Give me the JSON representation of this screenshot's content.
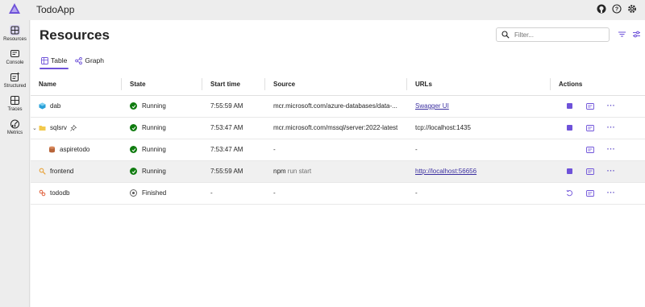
{
  "app": {
    "title": "TodoApp"
  },
  "sidebar": {
    "items": [
      {
        "label": "Resources",
        "icon": "resources-icon",
        "active": true
      },
      {
        "label": "Console",
        "icon": "console-icon"
      },
      {
        "label": "Structured",
        "icon": "structured-logs-icon"
      },
      {
        "label": "Traces",
        "icon": "traces-icon"
      },
      {
        "label": "Metrics",
        "icon": "metrics-icon"
      }
    ]
  },
  "header": {
    "title": "Resources",
    "filter_placeholder": "Filter..."
  },
  "tabs": [
    {
      "label": "Table",
      "icon": "table-icon",
      "active": true
    },
    {
      "label": "Graph",
      "icon": "graph-icon"
    }
  ],
  "table": {
    "columns": [
      "Name",
      "State",
      "Start time",
      "Source",
      "URLs",
      "Actions"
    ],
    "rows": [
      {
        "name": "dab",
        "icon": "container-icon",
        "state": "Running",
        "start": "7:55:59 AM",
        "source": "mcr.microsoft.com/azure-databases/data-...",
        "url": "Swagger UI",
        "url_link": true
      },
      {
        "name": "sqlsrv",
        "icon": "folder-icon",
        "state": "Running",
        "start": "7:53:47 AM",
        "source": "mcr.microsoft.com/mssql/server:2022-latest",
        "url": "tcp://localhost:1435",
        "url_link": false
      },
      {
        "name": "aspiretodo",
        "icon": "database-icon",
        "state": "Running",
        "start": "7:53:47 AM",
        "source": "-",
        "url": "-",
        "url_link": false
      },
      {
        "name": "frontend",
        "icon": "executable-icon",
        "state": "Running",
        "start": "7:55:59 AM",
        "source_main": "npm",
        "source_extra": "run start",
        "url": "http://localhost:56656",
        "url_link": true
      },
      {
        "name": "tododb",
        "icon": "project-icon",
        "state": "Finished",
        "start": "-",
        "source": "-",
        "url": "-",
        "url_link": false
      }
    ]
  },
  "colors": {
    "accent": "#6e52d9",
    "running": "#107c10",
    "link": "#3b2fa0"
  }
}
